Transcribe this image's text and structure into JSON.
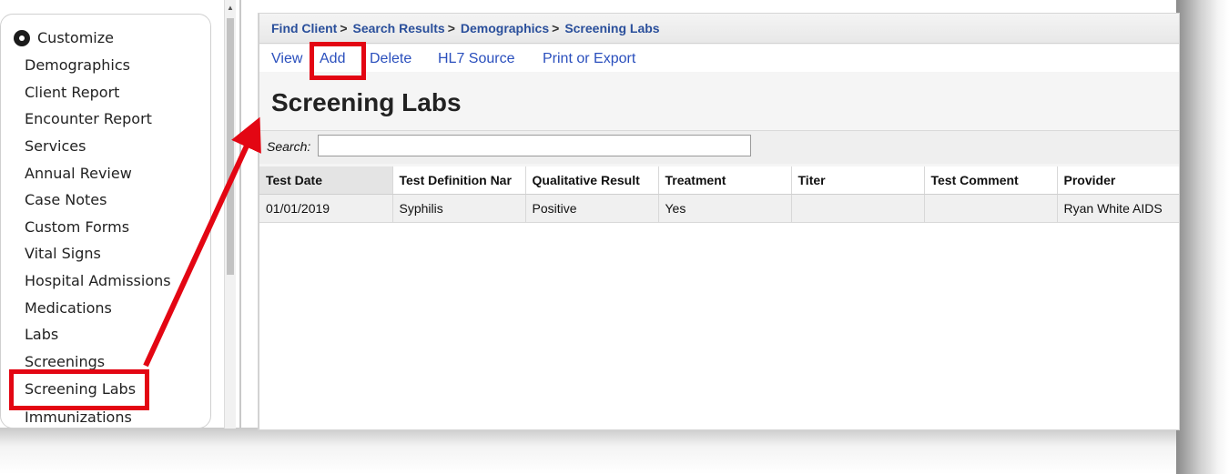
{
  "sidebar": {
    "customize_label": "Customize",
    "items": [
      {
        "label": "Demographics"
      },
      {
        "label": "Client Report"
      },
      {
        "label": "Encounter Report"
      },
      {
        "label": "Services"
      },
      {
        "label": "Annual Review"
      },
      {
        "label": "Case Notes"
      },
      {
        "label": "Custom Forms"
      },
      {
        "label": "Vital Signs"
      },
      {
        "label": "Hospital Admissions"
      },
      {
        "label": "Medications"
      },
      {
        "label": "Labs"
      },
      {
        "label": "Screenings"
      },
      {
        "label": "Screening Labs"
      },
      {
        "label": "Immunizations"
      }
    ]
  },
  "breadcrumb": {
    "items": [
      "Find Client",
      "Search Results",
      "Demographics",
      "Screening Labs"
    ],
    "separator": ">"
  },
  "toolbar": {
    "view": "View",
    "add": "Add",
    "delete": "Delete",
    "hl7": "HL7 Source",
    "print": "Print or Export"
  },
  "page": {
    "title": "Screening Labs",
    "search_label": "Search:",
    "search_value": ""
  },
  "table": {
    "columns": [
      "Test Date",
      "Test Definition Nar",
      "Qualitative Result",
      "Treatment",
      "Titer",
      "Test Comment",
      "Provider"
    ],
    "rows": [
      [
        "01/01/2019",
        "Syphilis",
        "Positive",
        "Yes",
        "",
        "",
        "Ryan White AIDS"
      ]
    ]
  },
  "annotations": {
    "highlight_color": "#e30613"
  }
}
